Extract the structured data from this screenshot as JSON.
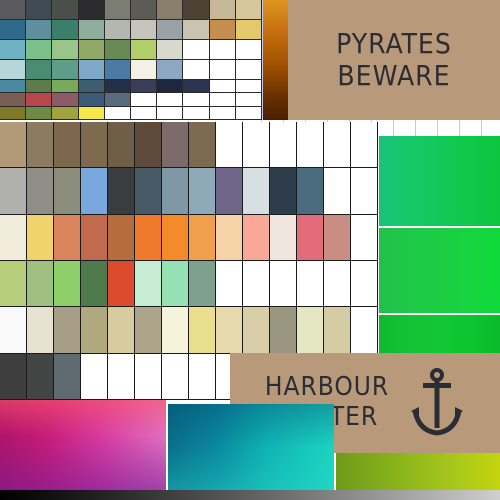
{
  "signs": {
    "pyrates": "PYRATES\nBEWARE",
    "harbour": "HARBOUR\nMASTER"
  },
  "palettes": {
    "top": {
      "cols": 10,
      "rows": 4,
      "colors": [
        "#5a5a5e",
        "#3f4a52",
        "#4a4f4c",
        "#2c2c2e",
        "#7c7d72",
        "#5c5b55",
        "#8a7f6a",
        "#4d4334",
        "#c7b899",
        "#d7c69a",
        "#2f6a8a",
        "#5e8f9a",
        "#3b7f6a",
        "#8fae9e",
        "#b2b8b0",
        "#c6c5bc",
        "#9aa2a8",
        "#c9c3b0",
        "#c48e4f",
        "#e4c86c",
        "#6fb0c2",
        "#7bbf8a",
        "#9bc48a",
        "#8fa864",
        "#6a8a55",
        "#b0cf6a",
        "#d9d8ce",
        "#ffffff",
        "#ffffff",
        "#ffffff",
        "#b6d6d8",
        "#4a8c73",
        "#5e9d89",
        "#7ea8c9",
        "#4c7aa6",
        "#f4f0e6",
        "#8da6c1",
        "#ffffff",
        "#ffffff",
        "#ffffff"
      ]
    },
    "top2": {
      "cols": 10,
      "rows": 3,
      "colors": [
        "#4a8aa0",
        "#5f7a4c",
        "#7aa85c",
        "#3c5e6e",
        "#24304a",
        "#3a3e56",
        "#1f2740",
        "#2a3552",
        "#ffffff",
        "#ffffff",
        "#7a5e56",
        "#b7474a",
        "#8d5b66",
        "#3d5a78",
        "#5a6b80",
        "#ffffff",
        "#ffffff",
        "#ffffff",
        "#ffffff",
        "#ffffff",
        "#7f7a2a",
        "#6e8a44",
        "#a1a33e",
        "#f4e84a",
        "#ffffff",
        "#ffffff",
        "#ffffff",
        "#ffffff",
        "#ffffff",
        "#ffffff"
      ]
    },
    "main": {
      "cols": 14,
      "rows": 6,
      "colors": [
        "#b29a79",
        "#8c7a61",
        "#7e684d",
        "#7d6a4f",
        "#6f5e48",
        "#5f4b3c",
        "#7d6a6b",
        "#7b6a50",
        "#ffffff",
        "#ffffff",
        "#ffffff",
        "#ffffff",
        "#ffffff",
        "#ffffff",
        "#b0b1ae",
        "#8e8e86",
        "#8a8d7c",
        "#7aa7dd",
        "#3a3d40",
        "#475a66",
        "#7f97a6",
        "#8eaab8",
        "#6f6689",
        "#d7dfe0",
        "#2d3d4a",
        "#4b6b7f",
        "#ffffff",
        "#ffffff",
        "#f2ecdc",
        "#f0d36a",
        "#d9845c",
        "#c26a4d",
        "#b56d3e",
        "#ef7a2b",
        "#f48b2a",
        "#f0a04a",
        "#f5d2a8",
        "#f7a896",
        "#f0e6e0",
        "#e36c7a",
        "#c98d83",
        "#ffffff",
        "#b7cf7a",
        "#9fbe7f",
        "#8fcf6a",
        "#4f7a4c",
        "#db4b2e",
        "#c6ecd3",
        "#96e0b5",
        "#7fa08e",
        "#ffffff",
        "#ffffff",
        "#ffffff",
        "#ffffff",
        "#ffffff",
        "#ffffff",
        "#fafafa",
        "#e6e2cf",
        "#a79e87",
        "#b0a87e",
        "#d6cca0",
        "#ada58a",
        "#f5f3dc",
        "#e9df8c",
        "#e6d9ac",
        "#d8cfa8",
        "#9a9680",
        "#e5e6c4",
        "#d5cba4",
        "#ffffff",
        "#3e3e3e",
        "#434545",
        "#5e6c71",
        "#ffffff",
        "#ffffff",
        "#ffffff",
        "#ffffff",
        "#ffffff",
        "#ffffff",
        "#ffffff",
        "#ffffff",
        "#ffffff",
        "#ffffff",
        "#ffffff"
      ]
    }
  }
}
